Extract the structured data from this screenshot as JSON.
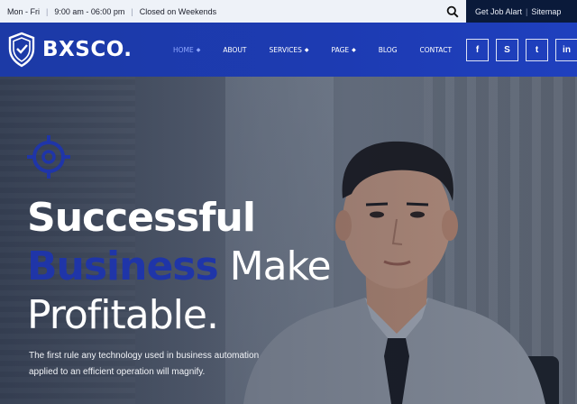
{
  "topbar": {
    "hours_days": "Mon - Fri",
    "hours_time": "9:00 am - 06:00 pm",
    "closed": "Closed on Weekends",
    "job_alert": "Get Job Alart",
    "sitemap": "Sitemap"
  },
  "header": {
    "brand": "BXSCO.",
    "nav": [
      {
        "label": "HOME",
        "dropdown": true,
        "active": true
      },
      {
        "label": "ABOUT",
        "dropdown": false
      },
      {
        "label": "SERVICES",
        "dropdown": true
      },
      {
        "label": "PAGE",
        "dropdown": true
      },
      {
        "label": "BLOG",
        "dropdown": false
      },
      {
        "label": "CONTACT",
        "dropdown": false
      }
    ],
    "caret": "◆",
    "socials": [
      {
        "name": "facebook-icon",
        "glyph": "f"
      },
      {
        "name": "skype-icon",
        "glyph": "S"
      },
      {
        "name": "twitter-icon",
        "glyph": "t"
      },
      {
        "name": "linkedin-icon",
        "glyph": "in"
      }
    ]
  },
  "hero": {
    "headline_1": "Successful",
    "headline_2_accent": "Business",
    "headline_2_rest": " Make",
    "headline_3": "Profitable.",
    "lead": "The first rule any technology used in business automation applied to an efficient operation will magnify.",
    "accent_color": "#1f35a8"
  },
  "colors": {
    "header_bg": "#1d3bb3",
    "topbar_bg": "#eef2f8",
    "alert_bg": "#0a1a3a",
    "active_nav": "#8ea6ff"
  }
}
